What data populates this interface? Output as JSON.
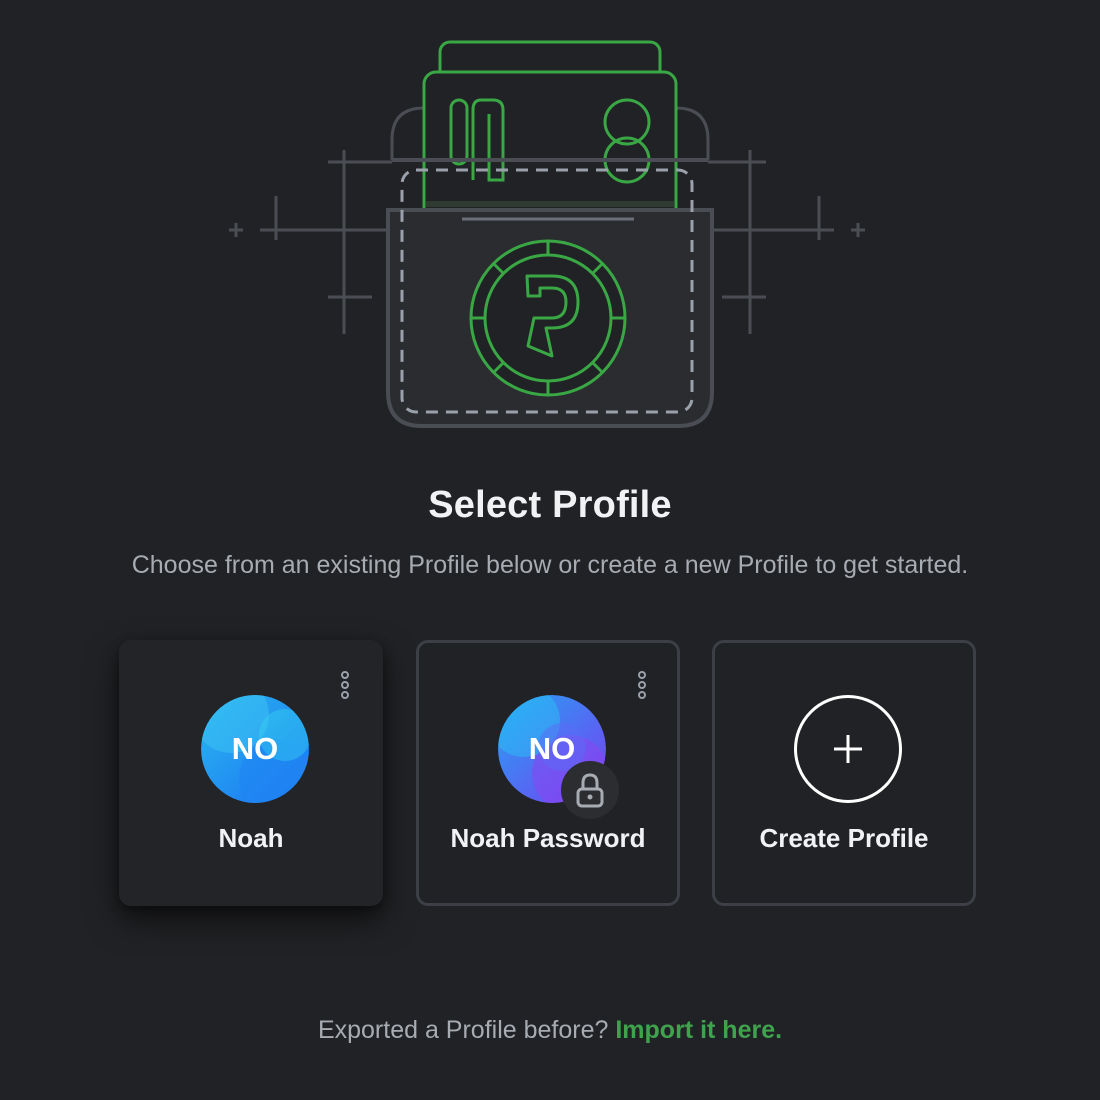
{
  "header": {
    "title": "Select Profile",
    "subtitle": "Choose from an existing Profile below or create a new Profile to get started."
  },
  "profiles": [
    {
      "name": "Noah",
      "initials": "NO",
      "locked": false,
      "selected": true,
      "menu_icon": "more-vertical-icon"
    },
    {
      "name": "Noah Password",
      "initials": "NO",
      "locked": true,
      "selected": false,
      "menu_icon": "more-vertical-icon",
      "lock_icon": "lock-icon"
    }
  ],
  "create": {
    "label": "Create Profile",
    "icon": "plus-icon"
  },
  "footer": {
    "text": "Exported a Profile before?",
    "link": "Import it here."
  },
  "colors": {
    "background": "#212225",
    "accent_green": "#3fa34d",
    "card_border": "#3c3f45",
    "muted_text": "#a7abb2"
  }
}
